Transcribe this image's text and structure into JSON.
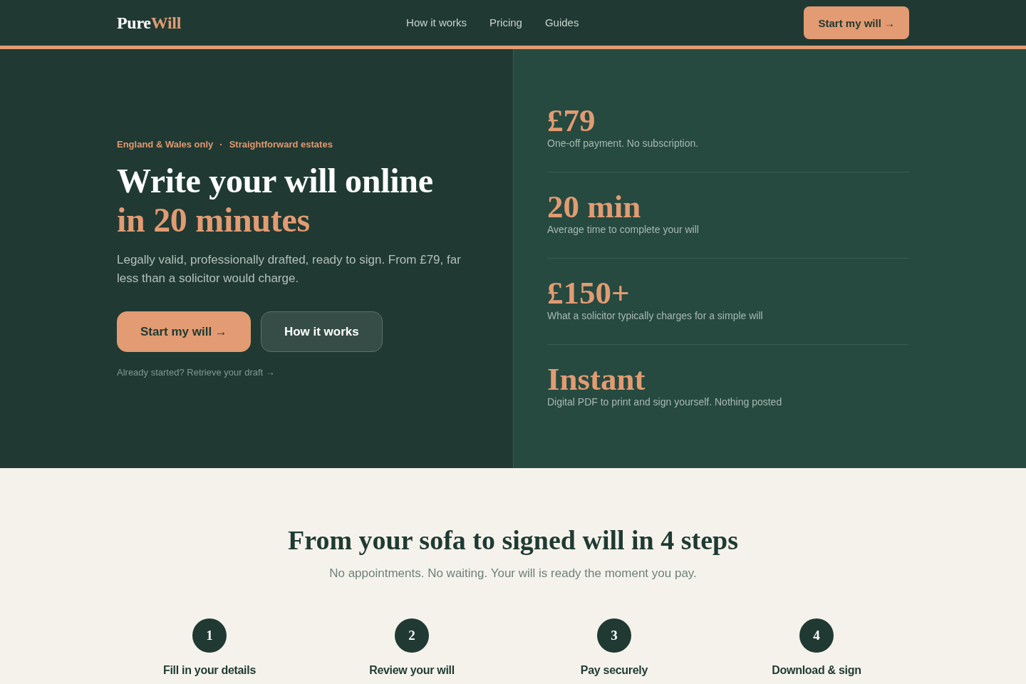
{
  "header": {
    "logo": {
      "text": "Pure",
      "accent": "Will"
    },
    "nav": [
      {
        "label": "How it works"
      },
      {
        "label": "Pricing"
      },
      {
        "label": "Guides"
      }
    ],
    "cta": "Start my will →"
  },
  "hero": {
    "eyebrow": {
      "items": [
        "England & Wales only",
        "Straightforward estates"
      ],
      "separator": "·"
    },
    "title": {
      "text": "Write your will online",
      "accent": "in 20 minutes"
    },
    "description": "Legally valid, professionally drafted, ready to sign. From £79, far less than a solicitor would charge.",
    "buttons": [
      {
        "kind": "primary",
        "label": "Start my will →"
      },
      {
        "kind": "secondary",
        "label": "How it works"
      }
    ],
    "draft_link": "Already started? Retrieve your draft →"
  },
  "stats": [
    {
      "value": "£79",
      "label": "One-off payment. No subscription."
    },
    {
      "value": "20 min",
      "label": "Average time to complete your will"
    },
    {
      "value": "£150+",
      "label": "What a solicitor typically charges for a simple will"
    },
    {
      "value": "Instant",
      "label": "Digital PDF to print and sign yourself. Nothing posted"
    }
  ],
  "steps_section": {
    "title": "From your sofa to signed will in 4 steps",
    "subtitle": "No appointments. No waiting. Your will is ready the moment you pay.",
    "steps": [
      {
        "number": "1",
        "title": "Fill in your details"
      },
      {
        "number": "2",
        "title": "Review your will"
      },
      {
        "number": "3",
        "title": "Pay securely"
      },
      {
        "number": "4",
        "title": "Download & sign"
      }
    ]
  }
}
